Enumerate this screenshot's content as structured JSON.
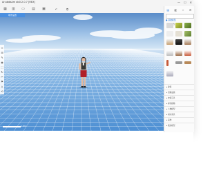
{
  "window": {
    "title": "Ar.abdaAm ab0.2.0.7 [REX]",
    "controls": [
      "—",
      "☐",
      "✕"
    ]
  },
  "toolbar": {
    "items": [
      "grid-icon",
      "barcode-icon",
      "folder-icon",
      "save-icon",
      "image-icon",
      "undo-icon",
      "redo-icon"
    ]
  },
  "doc_tab": {
    "label": "场景设置"
  },
  "left_tools": [
    "≡",
    "☰",
    "✎",
    "◉",
    "⬚",
    "↻",
    "✂",
    "⚑",
    "⌂",
    "⟲"
  ],
  "scale_label": "1.0m",
  "right_panel": {
    "icons": [
      "list-icon",
      "layers-icon",
      "star-icon",
      "settings-icon"
    ],
    "search": {
      "placeholder": "搜索模型"
    },
    "category": "● 基础模型",
    "list_items": [
      "▸ 建筑",
      "▸ 道路设施",
      "▸ 交通工具",
      "▸ 绿化植物",
      "▸ 人物模型",
      "▸ 城市家具",
      "▸ 其他",
      "▸ 我的模型"
    ]
  },
  "colors": {
    "sky_top": "#5f8fca",
    "sky_horizon": "#c6dcf0",
    "floor": "#6ea7dc",
    "grid": "#ffffff",
    "accent": "#2b7de0"
  }
}
